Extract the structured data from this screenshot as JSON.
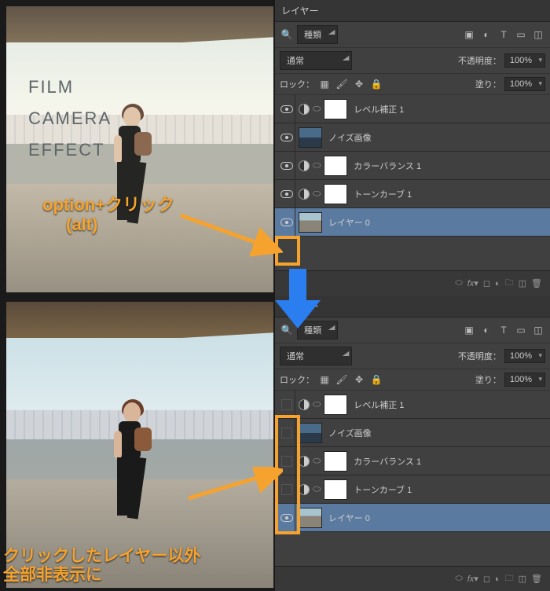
{
  "panel_title": "レイヤー",
  "filter": {
    "kind": "種類",
    "icons": [
      "image",
      "adjust",
      "text",
      "shape",
      "smart"
    ]
  },
  "blend": {
    "mode": "通常",
    "opacity_label": "不透明度：",
    "opacity_value": "100%"
  },
  "lock": {
    "label": "ロック：",
    "fill_label": "塗り：",
    "fill_value": "100%"
  },
  "layers_top": [
    {
      "name": "レベル補正 1",
      "visible": true,
      "type": "adj"
    },
    {
      "name": "ノイズ画像",
      "visible": true,
      "type": "img"
    },
    {
      "name": "カラーバランス 1",
      "visible": true,
      "type": "adj"
    },
    {
      "name": "トーンカーブ 1",
      "visible": true,
      "type": "adj"
    },
    {
      "name": "レイヤー 0",
      "visible": true,
      "type": "photo",
      "selected": true
    }
  ],
  "layers_bottom": [
    {
      "name": "レベル補正 1",
      "visible": false,
      "type": "adj"
    },
    {
      "name": "ノイズ画像",
      "visible": false,
      "type": "img"
    },
    {
      "name": "カラーバランス 1",
      "visible": false,
      "type": "adj"
    },
    {
      "name": "トーンカーブ 1",
      "visible": false,
      "type": "adj"
    },
    {
      "name": "レイヤー 0",
      "visible": true,
      "type": "photo",
      "selected": true
    }
  ],
  "footer_icons": [
    "link",
    "fx",
    "mask",
    "adjust",
    "group",
    "new",
    "trash"
  ],
  "canvas_text": {
    "l1": "FILM",
    "l2": "CAMERA",
    "l3": "EFFECT"
  },
  "annotations": {
    "top1": "option+クリック",
    "top2": "(alt)",
    "bottom1": "クリックしたレイヤー以外",
    "bottom2": "全部非表示に"
  }
}
